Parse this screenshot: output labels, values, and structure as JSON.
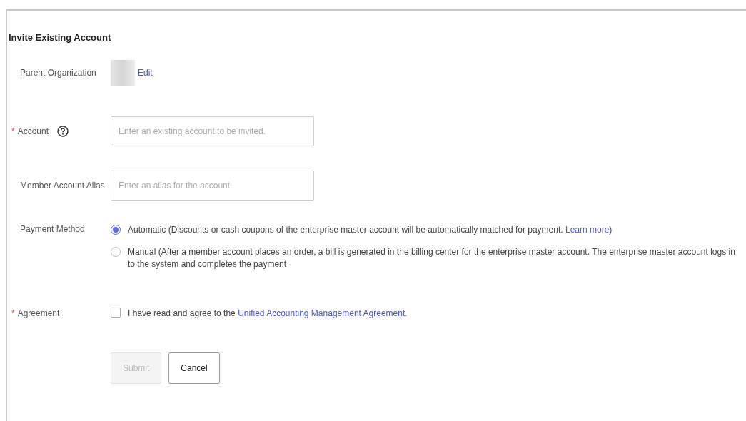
{
  "title": "Invite Existing Account",
  "parent_organization": {
    "label": "Parent Organization",
    "value_redacted": true,
    "edit_link": "Edit"
  },
  "account": {
    "label": "Account",
    "required_mark": "*",
    "help": true,
    "placeholder": "Enter an existing account to be invited."
  },
  "alias": {
    "label": "Member Account Alias",
    "placeholder": "Enter an alias for the account."
  },
  "payment_method": {
    "label": "Payment Method",
    "options": [
      {
        "text": "Automatic (Discounts or cash coupons of the enterprise master account will be automatically matched for payment. ",
        "link": "Learn more",
        "suffix": ")",
        "selected": true
      },
      {
        "text": "Manual (After a member account places an order, a bill is generated in the billing center for the enterprise master account. The enterprise master account logs in to the system and completes the payment",
        "selected": false
      }
    ]
  },
  "agreement": {
    "label": "Agreement",
    "required_mark": "*",
    "text": "I have read and agree to the ",
    "link": "Unified Accounting Management Agreement.",
    "checked": false
  },
  "buttons": [
    {
      "label": "Submit",
      "disabled": true
    },
    {
      "label": "Cancel",
      "disabled": false
    }
  ]
}
